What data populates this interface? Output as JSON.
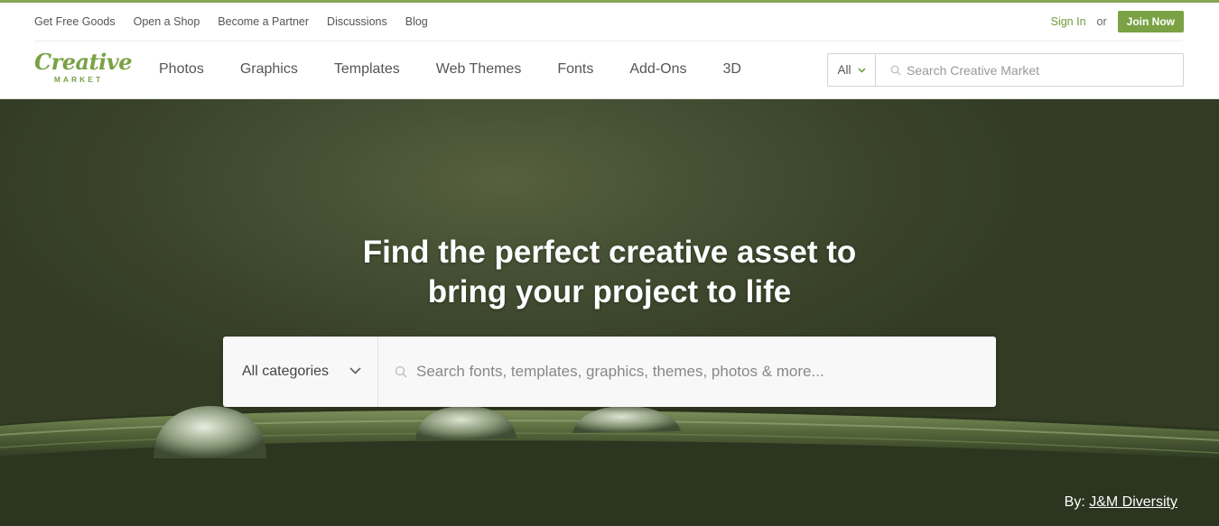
{
  "utility": {
    "links": [
      "Get Free Goods",
      "Open a Shop",
      "Become a Partner",
      "Discussions",
      "Blog"
    ],
    "sign_in": "Sign In",
    "or": "or",
    "join": "Join Now"
  },
  "logo": {
    "word": "Creative",
    "sub": "MARKET"
  },
  "nav": {
    "items": [
      "Photos",
      "Graphics",
      "Templates",
      "Web Themes",
      "Fonts",
      "Add-Ons",
      "3D"
    ],
    "search_scope": "All",
    "search_placeholder": "Search Creative Market"
  },
  "hero": {
    "title_line1": "Find the perfect creative asset to",
    "title_line2": "bring your project to life",
    "category": "All categories",
    "search_placeholder": "Search fonts, templates, graphics, themes, photos & more...",
    "credit_prefix": "By:",
    "credit_name": "J&M Diversity"
  },
  "colors": {
    "brand_green": "#7aa245",
    "top_line": "#8aa657"
  },
  "icons": [
    "search-icon",
    "chevron-down-icon"
  ]
}
